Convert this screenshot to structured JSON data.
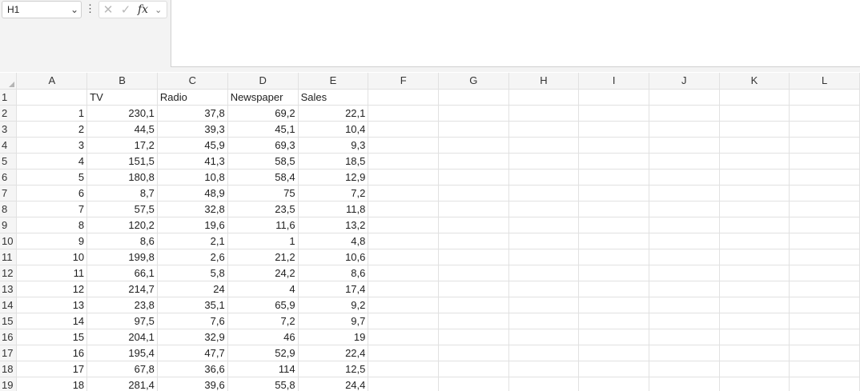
{
  "formula_bar": {
    "name_box": "H1",
    "name_box_arrow": "⌄",
    "more": "⋮",
    "cancel_glyph": "✕",
    "enter_glyph": "✓",
    "fx_label": "fx",
    "fx_dropdown": "⌄",
    "formula_value": ""
  },
  "columns": [
    "A",
    "B",
    "C",
    "D",
    "E",
    "F",
    "G",
    "H",
    "I",
    "J",
    "K",
    "L"
  ],
  "row_numbers": [
    "1",
    "2",
    "3",
    "4",
    "5",
    "6",
    "7",
    "8",
    "9",
    "10",
    "11",
    "12",
    "13",
    "14",
    "15",
    "16",
    "17",
    "18",
    "19"
  ],
  "rows": [
    [
      "",
      "TV",
      "Radio",
      "Newspaper",
      "Sales"
    ],
    [
      "1",
      "230,1",
      "37,8",
      "69,2",
      "22,1"
    ],
    [
      "2",
      "44,5",
      "39,3",
      "45,1",
      "10,4"
    ],
    [
      "3",
      "17,2",
      "45,9",
      "69,3",
      "9,3"
    ],
    [
      "4",
      "151,5",
      "41,3",
      "58,5",
      "18,5"
    ],
    [
      "5",
      "180,8",
      "10,8",
      "58,4",
      "12,9"
    ],
    [
      "6",
      "8,7",
      "48,9",
      "75",
      "7,2"
    ],
    [
      "7",
      "57,5",
      "32,8",
      "23,5",
      "11,8"
    ],
    [
      "8",
      "120,2",
      "19,6",
      "11,6",
      "13,2"
    ],
    [
      "9",
      "8,6",
      "2,1",
      "1",
      "4,8"
    ],
    [
      "10",
      "199,8",
      "2,6",
      "21,2",
      "10,6"
    ],
    [
      "11",
      "66,1",
      "5,8",
      "24,2",
      "8,6"
    ],
    [
      "12",
      "214,7",
      "24",
      "4",
      "17,4"
    ],
    [
      "13",
      "23,8",
      "35,1",
      "65,9",
      "9,2"
    ],
    [
      "14",
      "97,5",
      "7,6",
      "7,2",
      "9,7"
    ],
    [
      "15",
      "204,1",
      "32,9",
      "46",
      "19"
    ],
    [
      "16",
      "195,4",
      "47,7",
      "52,9",
      "22,4"
    ],
    [
      "17",
      "67,8",
      "36,6",
      "114",
      "12,5"
    ],
    [
      "18",
      "281,4",
      "39,6",
      "55,8",
      "24,4"
    ]
  ]
}
